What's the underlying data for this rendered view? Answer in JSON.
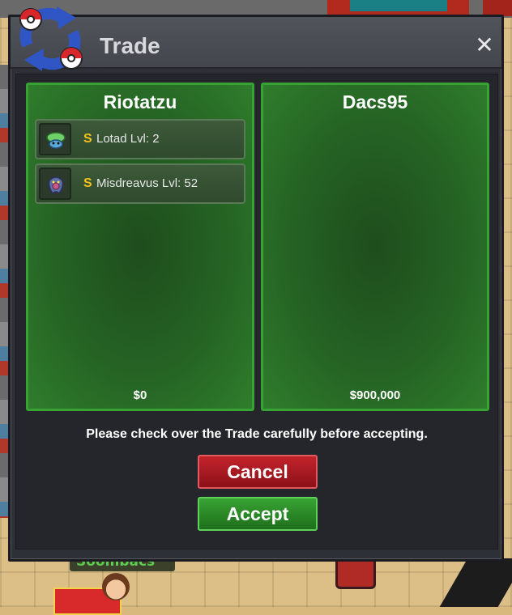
{
  "window": {
    "title": "Trade",
    "close_label": "✕"
  },
  "left_panel": {
    "player_name": "Riotatzu",
    "money": "$0",
    "pokemon": [
      {
        "shiny_marker": "S",
        "label": "Lotad  Lvl: 2",
        "icon": "lotad-sprite-icon"
      },
      {
        "shiny_marker": "S",
        "label": "Misdreavus  Lvl: 52",
        "icon": "misdreavus-sprite-icon"
      }
    ]
  },
  "right_panel": {
    "player_name": "Dacs95",
    "money": "$900,000",
    "pokemon": []
  },
  "notice": "Please check over the Trade carefully before accepting.",
  "buttons": {
    "cancel": "Cancel",
    "accept": "Accept"
  },
  "background": {
    "npc_name": "Soombacs"
  },
  "colors": {
    "panel_green": "#256324",
    "panel_border": "#37a332",
    "cancel_red": "#c3232b",
    "accept_green": "#38a333",
    "shiny_gold": "#f4c21b"
  }
}
